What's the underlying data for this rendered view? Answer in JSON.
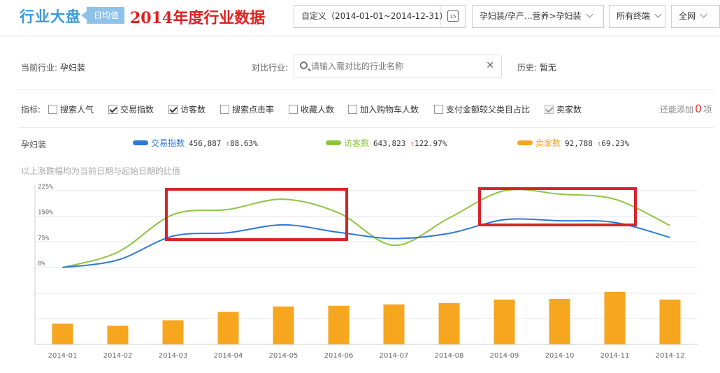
{
  "header": {
    "brand": "行业大盘",
    "badge": "日均值",
    "annotation_title": "2014年度行业数据",
    "date_range": "自定义（2014-01-01~2014-12-31）",
    "calendar_day": "15",
    "category": "孕妇装/孕产...营养>孕妇装",
    "terminal": "所有终端",
    "network": "全网"
  },
  "filters": {
    "current_label": "当前行业:",
    "current_value": "孕妇装",
    "compare_label": "对比行业:",
    "compare_placeholder": "请输入需对比的行业名称",
    "history_label": "历史:",
    "history_value": "暂无",
    "metrics_label": "指标:",
    "metrics": [
      {
        "label": "搜索人气",
        "checked": false
      },
      {
        "label": "交易指数",
        "checked": true
      },
      {
        "label": "访客数",
        "checked": true
      },
      {
        "label": "搜索点击率",
        "checked": false
      },
      {
        "label": "收藏人数",
        "checked": false
      },
      {
        "label": "加入购物车人数",
        "checked": false
      },
      {
        "label": "支付金额较父类目占比",
        "checked": false
      },
      {
        "label": "卖家数",
        "checked": true,
        "disabled": true
      }
    ],
    "remaining_prefix": "还能添加",
    "remaining_count": "0",
    "remaining_suffix": "项"
  },
  "legend": {
    "industry": "孕妇装",
    "items": [
      {
        "name": "交易指数",
        "value": "456,887",
        "change": "88.63%",
        "color": "#2f78d6"
      },
      {
        "name": "访客数",
        "value": "643,823",
        "change": "122.97%",
        "color": "#8cc63f"
      },
      {
        "name": "卖家数",
        "value": "92,788",
        "change": "69.23%",
        "color": "#f5a623"
      }
    ]
  },
  "note": "以上涨跌幅均为当前日期与起始日期的比值",
  "chart_data": {
    "type": "line",
    "categories": [
      "2014-01",
      "2014-02",
      "2014-03",
      "2014-04",
      "2014-05",
      "2014-06",
      "2014-07",
      "2014-08",
      "2014-09",
      "2014-10",
      "2014-11",
      "2014-12"
    ],
    "y_ticks": [
      "225%",
      "150%",
      "75%",
      "0%"
    ],
    "ylim": [
      0,
      225
    ],
    "series": [
      {
        "name": "交易指数",
        "color": "#2f78d6",
        "values": [
          0,
          22,
          92,
          102,
          125,
          103,
          85,
          100,
          140,
          137,
          132,
          88
        ]
      },
      {
        "name": "访客数",
        "color": "#8cc63f",
        "values": [
          0,
          45,
          155,
          170,
          200,
          160,
          65,
          145,
          225,
          215,
          200,
          123
        ]
      }
    ],
    "bars": {
      "name": "卖家数",
      "color": "#f7a61f",
      "values": [
        30,
        27,
        35,
        47,
        55,
        56,
        58,
        60,
        65,
        66,
        76,
        65
      ],
      "ylim": [
        0,
        100
      ]
    },
    "highlight_color": "#d9232a"
  }
}
